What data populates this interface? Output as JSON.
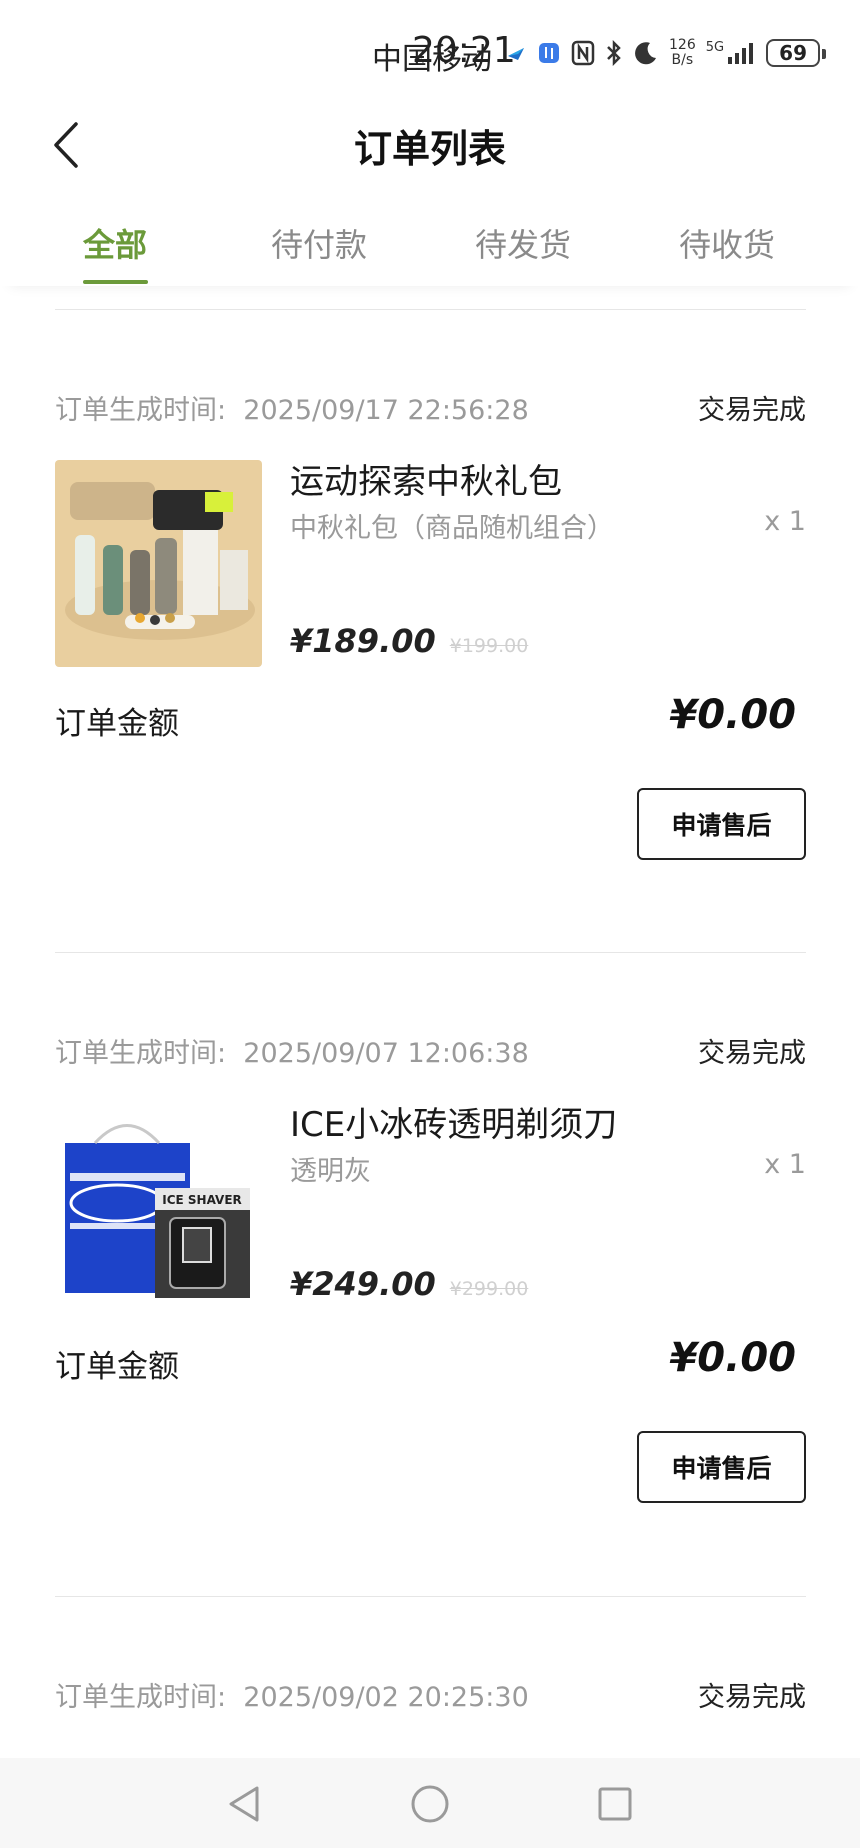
{
  "status_bar": {
    "carrier": "中国移动",
    "time": "20:21",
    "net_rate_top": "126",
    "net_rate_bottom": "B/s",
    "network_type": "5G",
    "battery": "69",
    "icons": [
      "app-notification-icon",
      "app-badge-icon",
      "nfc-icon",
      "bluetooth-icon",
      "do-not-disturb-moon-icon",
      "signal-icon",
      "battery-icon"
    ]
  },
  "header": {
    "title": "订单列表",
    "back_icon": "chevron-left-icon"
  },
  "tabs": [
    {
      "label": "全部",
      "active": true
    },
    {
      "label": "待付款",
      "active": false
    },
    {
      "label": "待发货",
      "active": false
    },
    {
      "label": "待收货",
      "active": false
    }
  ],
  "orders": [
    {
      "time_label": "订单生成时间:",
      "time": "2025/09/17 22:56:28",
      "status": "交易完成",
      "product_name": "运动探索中秋礼包",
      "product_spec": "中秋礼包（商品随机组合）",
      "qty": "x 1",
      "price": "¥189.00",
      "original_price": "¥199.00",
      "amount_label": "订单金额",
      "amount": "¥0.00",
      "action": "申请售后"
    },
    {
      "time_label": "订单生成时间:",
      "time": "2025/09/07 12:06:38",
      "status": "交易完成",
      "product_name": "ICE小冰砖透明剃须刀",
      "product_spec": "透明灰",
      "qty": "x 1",
      "price": "¥249.00",
      "original_price": "¥299.00",
      "amount_label": "订单金额",
      "amount": "¥0.00",
      "action": "申请售后",
      "image_text": "ICE SHAVER"
    },
    {
      "time_label": "订单生成时间:",
      "time": "2025/09/02 20:25:30",
      "status": "交易完成"
    }
  ],
  "nav_bar": {
    "back": "nav-back-triangle-icon",
    "home": "nav-home-circle-icon",
    "recents": "nav-recents-square-icon"
  },
  "colors": {
    "accent": "#6b9a3a",
    "muted_text": "#9a9a9a",
    "original_price": "#d0d0d0"
  }
}
